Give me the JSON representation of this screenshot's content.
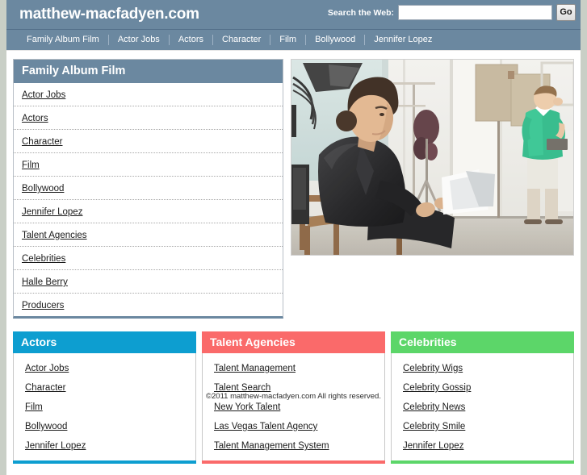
{
  "header": {
    "site_title": "matthew-macfadyen.com",
    "search_label": "Search the Web:",
    "search_value": "",
    "search_placeholder": "",
    "go_label": "Go"
  },
  "nav": {
    "items": [
      {
        "label": "Family Album Film"
      },
      {
        "label": "Actor Jobs"
      },
      {
        "label": "Actors"
      },
      {
        "label": "Character"
      },
      {
        "label": "Film"
      },
      {
        "label": "Bollywood"
      },
      {
        "label": "Jennifer Lopez"
      }
    ]
  },
  "main_panel": {
    "title": "Family Album Film",
    "header_color": "#6b88a0",
    "items": [
      {
        "label": "Actor Jobs"
      },
      {
        "label": "Actors"
      },
      {
        "label": "Character"
      },
      {
        "label": "Film"
      },
      {
        "label": "Bollywood"
      },
      {
        "label": "Jennifer Lopez"
      },
      {
        "label": "Talent Agencies"
      },
      {
        "label": "Celebrities"
      },
      {
        "label": "Halle Berry"
      },
      {
        "label": "Producers"
      }
    ]
  },
  "hero": {
    "alt": "Man in black suit seated reading a script on a film set with crew member in green shirt standing"
  },
  "panels": [
    {
      "title": "Actors",
      "color": "#0d9ed0",
      "items": [
        {
          "label": "Actor Jobs"
        },
        {
          "label": "Character"
        },
        {
          "label": "Film"
        },
        {
          "label": "Bollywood"
        },
        {
          "label": "Jennifer Lopez"
        }
      ]
    },
    {
      "title": "Talent Agencies",
      "color": "#fa6a6a",
      "items": [
        {
          "label": "Talent Management"
        },
        {
          "label": "Talent Search"
        },
        {
          "label": "New York Talent"
        },
        {
          "label": "Las Vegas Talent Agency"
        },
        {
          "label": "Talent Management System"
        }
      ]
    },
    {
      "title": "Celebrities",
      "color": "#5cd669",
      "items": [
        {
          "label": "Celebrity Wigs"
        },
        {
          "label": "Celebrity Gossip"
        },
        {
          "label": "Celebrity News"
        },
        {
          "label": "Celebrity Smile"
        },
        {
          "label": "Jennifer Lopez"
        }
      ]
    }
  ],
  "footer": {
    "copyright": "©2011  matthew-macfadyen.com All rights reserved."
  }
}
